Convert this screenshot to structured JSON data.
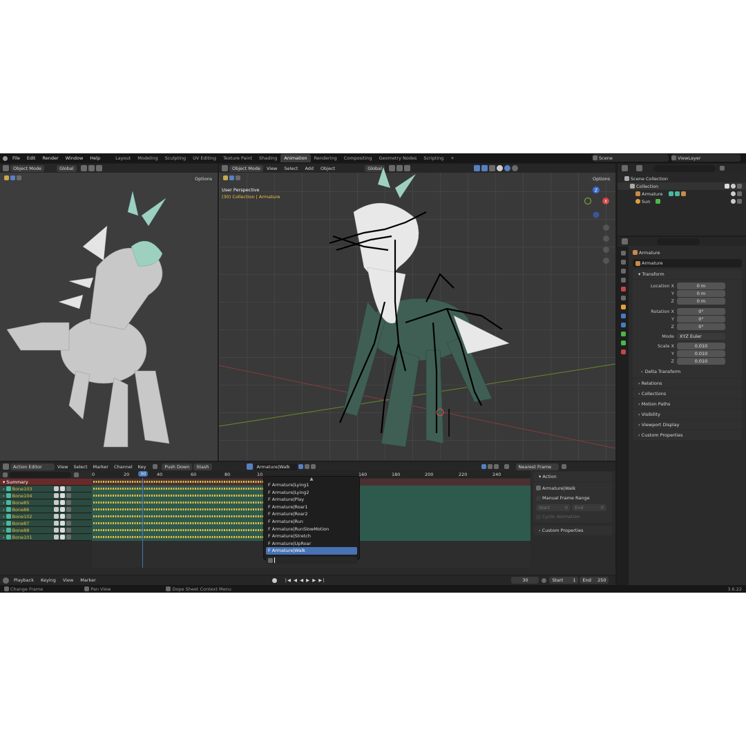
{
  "menus": [
    "File",
    "Edit",
    "Render",
    "Window",
    "Help"
  ],
  "workspaces": [
    "Layout",
    "Modeling",
    "Sculpting",
    "UV Editing",
    "Texture Paint",
    "Shading",
    "Animation",
    "Rendering",
    "Compositing",
    "Geometry Nodes",
    "Scripting"
  ],
  "active_workspace": "Animation",
  "scene": "Scene",
  "view_layer": "ViewLayer",
  "left_viewport": {
    "mode": "Object Mode",
    "transform": "Global",
    "options": "Options"
  },
  "main_viewport": {
    "mode": "Object Mode",
    "view": "View",
    "select": "Select",
    "add": "Add",
    "object": "Object",
    "transform": "Global",
    "options": "Options",
    "title": "User Perspective",
    "subtitle": "(30) Collection | Armature"
  },
  "outliner": {
    "root": "Scene Collection",
    "collection": "Collection",
    "items": [
      {
        "name": "Armature"
      },
      {
        "name": "Sun"
      }
    ]
  },
  "properties": {
    "object_name": "Armature",
    "data_name": "Armature",
    "transform_label": "Transform",
    "location": {
      "label": "Location X",
      "x": "0 m",
      "y": "0 m",
      "z": "0 m"
    },
    "rotation": {
      "label": "Rotation X",
      "x": "0°",
      "y": "0°",
      "z": "0°"
    },
    "mode_label": "Mode",
    "mode_value": "XYZ Euler",
    "scale": {
      "label": "Scale X",
      "x": "0.010",
      "y": "0.010",
      "z": "0.010"
    },
    "axis_y": "Y",
    "axis_z": "Z",
    "sections": [
      "Delta Transform",
      "Relations",
      "Collections",
      "Motion Paths",
      "Visibility",
      "Viewport Display",
      "Custom Properties"
    ]
  },
  "action_editor": {
    "editor": "Action Editor",
    "menus": [
      "View",
      "Select",
      "Marker",
      "Channel",
      "Key"
    ],
    "push_down": "Push Down",
    "stash": "Stash",
    "action": "Armature|Walk",
    "snap": "Nearest Frame",
    "current_frame": "30",
    "ruler": [
      "0",
      "20",
      "40",
      "60",
      "80",
      "10",
      "160",
      "180",
      "200",
      "220",
      "240"
    ],
    "channels": [
      "Summary",
      "Bone103",
      "Bone104",
      "Bone85",
      "Bone86",
      "Bone102",
      "Bone87",
      "Bone88",
      "Bone101"
    ],
    "action_list": [
      "F Armature|Lying1",
      "F Armature|Lying2",
      "F Armature|Play",
      "F Armature|Roar1",
      "F Armature|Roar2",
      "F Armature|Run",
      "F Armature|RunSlowMotion",
      "F Armature|Stretch",
      "F Armature|UpRoar",
      "F Armature|Walk"
    ],
    "sidebar": {
      "action_header": "Action",
      "action_name": "Armature|Walk",
      "manual_range": "Manual Frame Range",
      "start_label": "Start",
      "start_val": "0",
      "end_label": "End",
      "end_val": "0",
      "cyclic": "Cyclic Animation",
      "custom_props": "Custom Properties"
    }
  },
  "timeline": {
    "menus": [
      "Playback",
      "Keying",
      "View",
      "Marker"
    ],
    "frame": "30",
    "start_label": "Start",
    "start": "1",
    "end_label": "End",
    "end": "250"
  },
  "status": {
    "left": "Change Frame",
    "mid": "Pan View",
    "right": "Dope Sheet Context Menu",
    "version": "3.6.22"
  }
}
